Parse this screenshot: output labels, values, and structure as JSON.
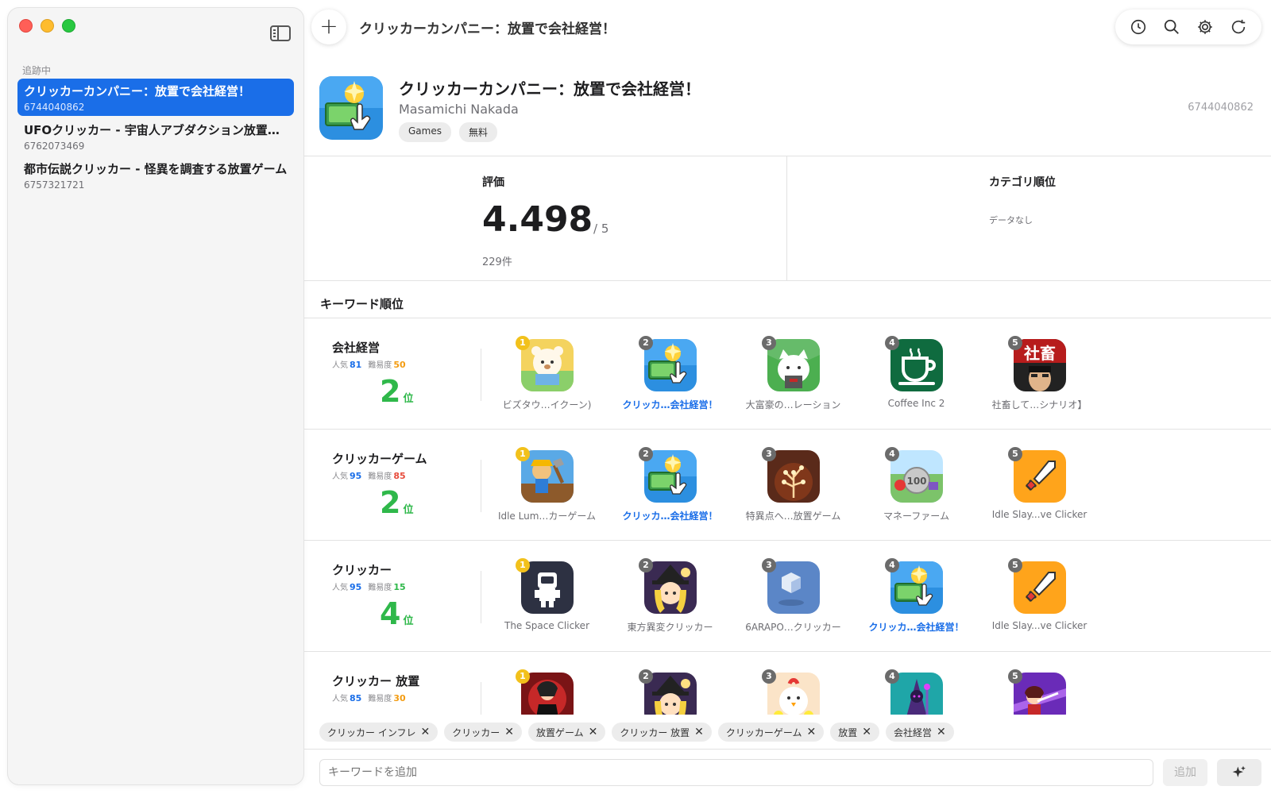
{
  "sidebar": {
    "section_label": "追跡中",
    "items": [
      {
        "name": "クリッカーカンパニー：放置で会社経営！",
        "id": "6744040862"
      },
      {
        "name": "UFOクリッカー - 宇宙人アブダクション放置…",
        "id": "6762073469"
      },
      {
        "name": "都市伝説クリッカー - 怪異を調査する放置ゲーム",
        "id": "6757321721"
      }
    ]
  },
  "toolbar": {
    "plus_label": "+",
    "title": "クリッカーカンパニー：放置で会社経営！"
  },
  "app": {
    "title": "クリッカーカンパニー：放置で会社経営！",
    "developer": "Masamichi Nakada",
    "tags": [
      "Games",
      "無料"
    ],
    "id": "6744040862"
  },
  "stats": {
    "rating_label": "評価",
    "rating_value": "4.498",
    "rating_max": "/ 5",
    "rating_count": "229件",
    "category_label": "カテゴリ順位",
    "category_value": "データなし"
  },
  "keywords": {
    "title": "キーワード順位",
    "popularity_label": "人気",
    "difficulty_label": "難易度",
    "rank_suffix": "位",
    "rows": [
      {
        "keyword": "会社経営",
        "popularity": "81",
        "difficulty": "50",
        "difficulty_color": "#f39c12",
        "rank": "2",
        "apps": [
          {
            "rank": "1",
            "label": "ビズタウ…イクーン)",
            "self": false,
            "icon": "bear-icon"
          },
          {
            "rank": "2",
            "label": "クリッカ…会社経営！",
            "self": true,
            "icon": "money-click-icon"
          },
          {
            "rank": "3",
            "label": "大富豪の…レーション",
            "self": false,
            "icon": "cat-icon"
          },
          {
            "rank": "4",
            "label": "Coffee Inc 2",
            "self": false,
            "icon": "coffee-icon"
          },
          {
            "rank": "5",
            "label": "社畜して…シナリオ】",
            "self": false,
            "icon": "shachiku-icon"
          }
        ]
      },
      {
        "keyword": "クリッカーゲーム",
        "popularity": "95",
        "difficulty": "85",
        "difficulty_color": "#e74c3c",
        "rank": "2",
        "apps": [
          {
            "rank": "1",
            "label": "Idle Lum…カーゲーム",
            "self": false,
            "icon": "lumberjack-icon"
          },
          {
            "rank": "2",
            "label": "クリッカ…会社経営！",
            "self": true,
            "icon": "money-click-icon"
          },
          {
            "rank": "3",
            "label": "特異点へ…放置ゲーム",
            "self": false,
            "icon": "tree-icon"
          },
          {
            "rank": "4",
            "label": "マネーファーム",
            "self": false,
            "icon": "coin-farm-icon"
          },
          {
            "rank": "5",
            "label": "Idle Slay...ve Clicker",
            "self": false,
            "icon": "sword-icon"
          }
        ]
      },
      {
        "keyword": "クリッカー",
        "popularity": "95",
        "difficulty": "15",
        "difficulty_color": "#2fb84a",
        "rank": "4",
        "apps": [
          {
            "rank": "1",
            "label": "The Space Clicker",
            "self": false,
            "icon": "astronaut-icon"
          },
          {
            "rank": "2",
            "label": "東方異変クリッカー",
            "self": false,
            "icon": "witch-icon"
          },
          {
            "rank": "3",
            "label": "6ARAPO…クリッカー",
            "self": false,
            "icon": "cube-icon"
          },
          {
            "rank": "4",
            "label": "クリッカ…会社経営！",
            "self": true,
            "icon": "money-click-icon"
          },
          {
            "rank": "5",
            "label": "Idle Slay...ve Clicker",
            "self": false,
            "icon": "sword-icon"
          }
        ]
      },
      {
        "keyword": "クリッカー 放置",
        "popularity": "85",
        "difficulty": "30",
        "difficulty_color": "#f39c12",
        "rank": "",
        "apps": [
          {
            "rank": "1",
            "label": "",
            "self": false,
            "icon": "warrior-icon"
          },
          {
            "rank": "2",
            "label": "",
            "self": false,
            "icon": "witch-icon"
          },
          {
            "rank": "3",
            "label": "",
            "self": false,
            "icon": "chicken-icon"
          },
          {
            "rank": "4",
            "label": "",
            "self": false,
            "icon": "wizard-icon"
          },
          {
            "rank": "5",
            "label": "",
            "self": false,
            "icon": "purple-girl-icon"
          }
        ]
      }
    ]
  },
  "chips": [
    "クリッカー インフレ",
    "クリッカー",
    "放置ゲーム",
    "クリッカー 放置",
    "クリッカーゲーム",
    "放置",
    "会社経営"
  ],
  "input": {
    "placeholder": "キーワードを追加",
    "add_label": "追加"
  }
}
